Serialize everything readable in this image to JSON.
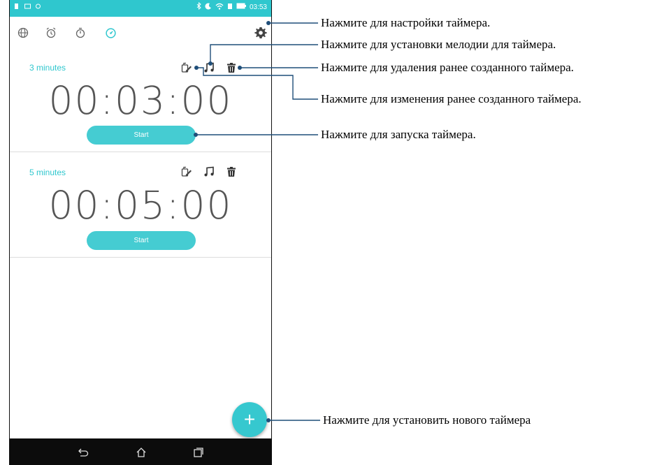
{
  "status_bar": {
    "time": "03:53",
    "color": "#2fc7ce"
  },
  "toolbar": {
    "icons": [
      "globe-icon",
      "alarm-icon",
      "stopwatch-icon",
      "timer-icon",
      "gear-icon"
    ],
    "active_color": "#2fc7ce"
  },
  "timers": [
    {
      "label": "3 minutes",
      "time": "00:03:00",
      "start_label": "Start"
    },
    {
      "label": "5 minutes",
      "time": "00:05:00",
      "start_label": "Start"
    }
  ],
  "fab": {
    "label": "+"
  },
  "callouts": {
    "settings": "Нажмите для настройки таймера.",
    "ringtone": "Нажмите для установки мелодии для таймера.",
    "delete": "Нажмите для удаления ранее созданного таймера.",
    "edit": "Нажмите для изменения ранее созданного таймера.",
    "start": "Нажмите для запуска таймера.",
    "add": "Нажмите для установить нового таймера"
  },
  "colors": {
    "accent": "#2fc7ce",
    "button": "#45ccd2",
    "callout_line": "#1f4e79"
  }
}
